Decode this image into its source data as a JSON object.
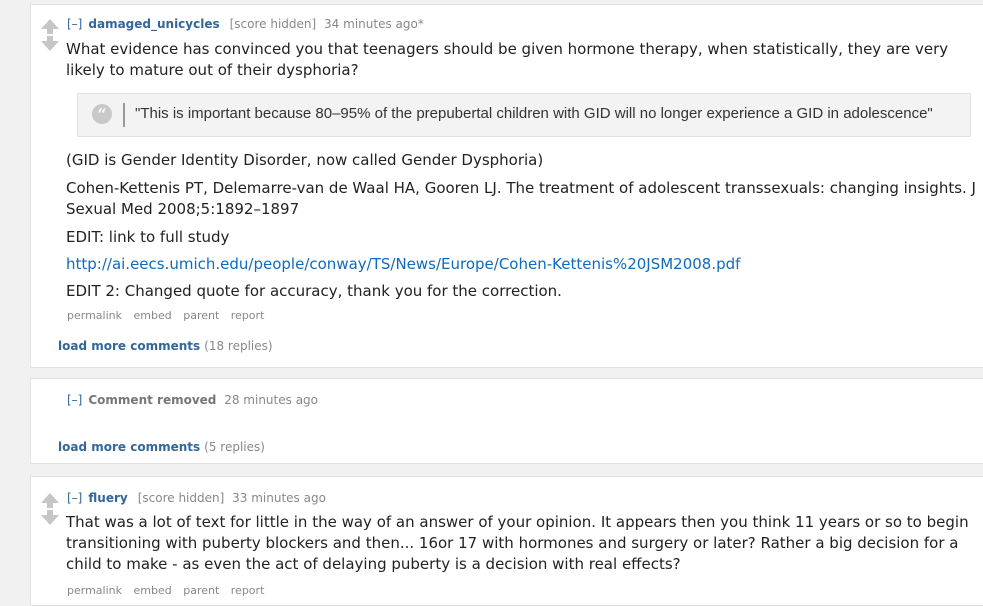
{
  "comments": [
    {
      "expand": "[–]",
      "author": "damaged_unicycles",
      "score": "[score hidden]",
      "time": "34 minutes ago*",
      "paragraph1": "What evidence has convinced you that teenagers should be given hormone therapy, when statistically, they are very likely to mature out of their dysphoria?",
      "quote": "\"This is important because 80–95% of the prepubertal children with GID will no longer experience a GID in adolescence\"",
      "paragraph2": "(GID is Gender Identity Disorder, now called Gender Dysphoria)",
      "paragraph3": "Cohen-Kettenis PT, Delemarre-van de Waal HA, Gooren LJ. The treatment of adolescent transsexuals: changing insights. J Sexual Med 2008;5:1892–1897",
      "paragraph4": "EDIT: link to full study",
      "link": "http://ai.eecs.umich.edu/people/conway/TS/News/Europe/Cohen-Kettenis%20JSM2008.pdf",
      "paragraph5": "EDIT 2: Changed quote for accuracy, thank you for the correction.",
      "buttons": [
        "permalink",
        "embed",
        "parent",
        "report"
      ],
      "more_label": "load more comments",
      "more_count": "(18 replies)"
    },
    {
      "expand": "[–]",
      "removed_label": "Comment removed",
      "time": "28 minutes ago",
      "more_label": "load more comments",
      "more_count": "(5 replies)"
    },
    {
      "expand": "[–]",
      "author": "fluery",
      "score": "[score hidden]",
      "time": "33 minutes ago",
      "paragraph1": "That was a lot of text for little in the way of an answer of your opinion. It appears then you think 11 years or so to begin transitioning with puberty blockers and then... 16or 17 with hormones and surgery or later? Rather a big decision for a child to make - as even the act of delaying puberty is a decision with real effects?",
      "buttons": [
        "permalink",
        "embed",
        "parent",
        "report"
      ]
    }
  ]
}
